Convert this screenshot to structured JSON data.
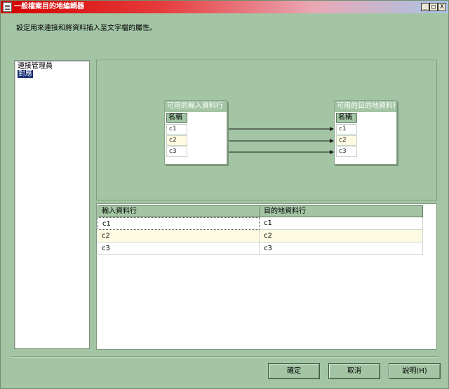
{
  "window": {
    "title": "一般檔案目的地編輯器",
    "controls": {
      "minimize": "_",
      "maximize": "□",
      "close": "X"
    }
  },
  "description": "設定用來連接和將資料插入至文字檔的屬性。",
  "left_nav": {
    "items": [
      {
        "label": "連接管理員",
        "selected": false
      },
      {
        "label": "對應",
        "selected": true
      }
    ]
  },
  "mapping": {
    "input_table": {
      "title": "可用的輸入資料行",
      "column_header": "名稱",
      "columns": [
        "c1",
        "c2",
        "c3"
      ]
    },
    "output_table": {
      "title": "可用的目的地資料行",
      "column_header": "名稱",
      "columns": [
        "c1",
        "c2",
        "c3"
      ]
    }
  },
  "grid": {
    "headers": [
      "輸入資料行",
      "目的地資料行"
    ],
    "rows": [
      [
        "c1",
        "c1"
      ],
      [
        "c2",
        "c2"
      ],
      [
        "c3",
        "c3"
      ]
    ]
  },
  "buttons": {
    "ok": "確定",
    "cancel": "取消",
    "help": "說明(H)"
  },
  "colors": {
    "window_bg": "#a3c5a4",
    "selection": "#0a246a",
    "alt_row": "#fffbe3"
  }
}
